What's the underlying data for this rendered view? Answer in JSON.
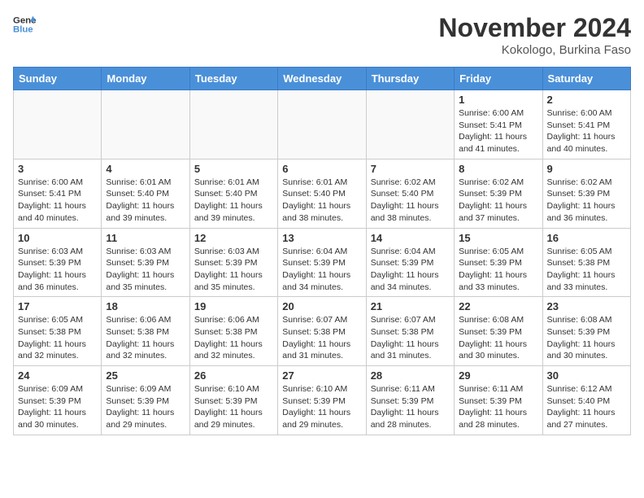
{
  "header": {
    "logo_line1": "General",
    "logo_line2": "Blue",
    "month": "November 2024",
    "location": "Kokologo, Burkina Faso"
  },
  "weekdays": [
    "Sunday",
    "Monday",
    "Tuesday",
    "Wednesday",
    "Thursday",
    "Friday",
    "Saturday"
  ],
  "weeks": [
    [
      {
        "day": "",
        "info": ""
      },
      {
        "day": "",
        "info": ""
      },
      {
        "day": "",
        "info": ""
      },
      {
        "day": "",
        "info": ""
      },
      {
        "day": "",
        "info": ""
      },
      {
        "day": "1",
        "info": "Sunrise: 6:00 AM\nSunset: 5:41 PM\nDaylight: 11 hours and 41 minutes."
      },
      {
        "day": "2",
        "info": "Sunrise: 6:00 AM\nSunset: 5:41 PM\nDaylight: 11 hours and 40 minutes."
      }
    ],
    [
      {
        "day": "3",
        "info": "Sunrise: 6:00 AM\nSunset: 5:41 PM\nDaylight: 11 hours and 40 minutes."
      },
      {
        "day": "4",
        "info": "Sunrise: 6:01 AM\nSunset: 5:40 PM\nDaylight: 11 hours and 39 minutes."
      },
      {
        "day": "5",
        "info": "Sunrise: 6:01 AM\nSunset: 5:40 PM\nDaylight: 11 hours and 39 minutes."
      },
      {
        "day": "6",
        "info": "Sunrise: 6:01 AM\nSunset: 5:40 PM\nDaylight: 11 hours and 38 minutes."
      },
      {
        "day": "7",
        "info": "Sunrise: 6:02 AM\nSunset: 5:40 PM\nDaylight: 11 hours and 38 minutes."
      },
      {
        "day": "8",
        "info": "Sunrise: 6:02 AM\nSunset: 5:39 PM\nDaylight: 11 hours and 37 minutes."
      },
      {
        "day": "9",
        "info": "Sunrise: 6:02 AM\nSunset: 5:39 PM\nDaylight: 11 hours and 36 minutes."
      }
    ],
    [
      {
        "day": "10",
        "info": "Sunrise: 6:03 AM\nSunset: 5:39 PM\nDaylight: 11 hours and 36 minutes."
      },
      {
        "day": "11",
        "info": "Sunrise: 6:03 AM\nSunset: 5:39 PM\nDaylight: 11 hours and 35 minutes."
      },
      {
        "day": "12",
        "info": "Sunrise: 6:03 AM\nSunset: 5:39 PM\nDaylight: 11 hours and 35 minutes."
      },
      {
        "day": "13",
        "info": "Sunrise: 6:04 AM\nSunset: 5:39 PM\nDaylight: 11 hours and 34 minutes."
      },
      {
        "day": "14",
        "info": "Sunrise: 6:04 AM\nSunset: 5:39 PM\nDaylight: 11 hours and 34 minutes."
      },
      {
        "day": "15",
        "info": "Sunrise: 6:05 AM\nSunset: 5:39 PM\nDaylight: 11 hours and 33 minutes."
      },
      {
        "day": "16",
        "info": "Sunrise: 6:05 AM\nSunset: 5:38 PM\nDaylight: 11 hours and 33 minutes."
      }
    ],
    [
      {
        "day": "17",
        "info": "Sunrise: 6:05 AM\nSunset: 5:38 PM\nDaylight: 11 hours and 32 minutes."
      },
      {
        "day": "18",
        "info": "Sunrise: 6:06 AM\nSunset: 5:38 PM\nDaylight: 11 hours and 32 minutes."
      },
      {
        "day": "19",
        "info": "Sunrise: 6:06 AM\nSunset: 5:38 PM\nDaylight: 11 hours and 32 minutes."
      },
      {
        "day": "20",
        "info": "Sunrise: 6:07 AM\nSunset: 5:38 PM\nDaylight: 11 hours and 31 minutes."
      },
      {
        "day": "21",
        "info": "Sunrise: 6:07 AM\nSunset: 5:38 PM\nDaylight: 11 hours and 31 minutes."
      },
      {
        "day": "22",
        "info": "Sunrise: 6:08 AM\nSunset: 5:39 PM\nDaylight: 11 hours and 30 minutes."
      },
      {
        "day": "23",
        "info": "Sunrise: 6:08 AM\nSunset: 5:39 PM\nDaylight: 11 hours and 30 minutes."
      }
    ],
    [
      {
        "day": "24",
        "info": "Sunrise: 6:09 AM\nSunset: 5:39 PM\nDaylight: 11 hours and 30 minutes."
      },
      {
        "day": "25",
        "info": "Sunrise: 6:09 AM\nSunset: 5:39 PM\nDaylight: 11 hours and 29 minutes."
      },
      {
        "day": "26",
        "info": "Sunrise: 6:10 AM\nSunset: 5:39 PM\nDaylight: 11 hours and 29 minutes."
      },
      {
        "day": "27",
        "info": "Sunrise: 6:10 AM\nSunset: 5:39 PM\nDaylight: 11 hours and 29 minutes."
      },
      {
        "day": "28",
        "info": "Sunrise: 6:11 AM\nSunset: 5:39 PM\nDaylight: 11 hours and 28 minutes."
      },
      {
        "day": "29",
        "info": "Sunrise: 6:11 AM\nSunset: 5:39 PM\nDaylight: 11 hours and 28 minutes."
      },
      {
        "day": "30",
        "info": "Sunrise: 6:12 AM\nSunset: 5:40 PM\nDaylight: 11 hours and 27 minutes."
      }
    ]
  ]
}
